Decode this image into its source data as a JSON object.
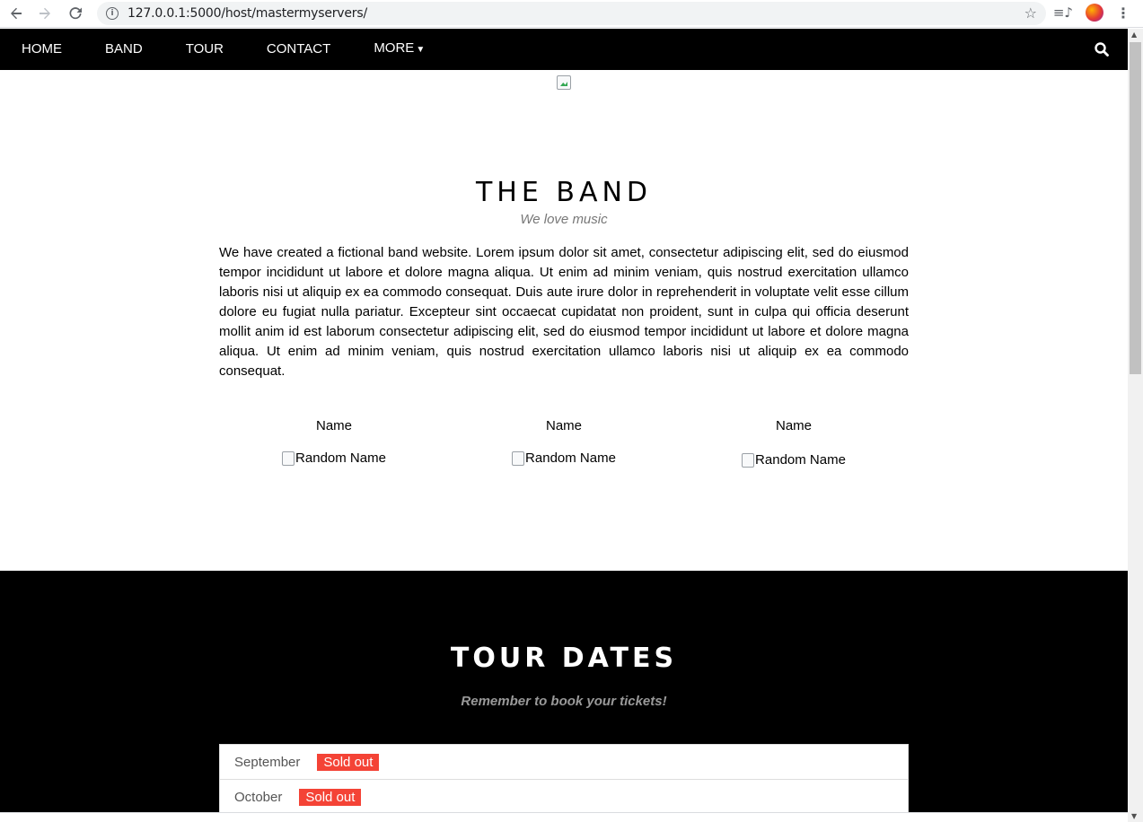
{
  "browser": {
    "url": "127.0.0.1:5000/host/mastermyservers/"
  },
  "nav": {
    "items": [
      "HOME",
      "BAND",
      "TOUR",
      "CONTACT",
      "MORE"
    ],
    "more_caret": "▼"
  },
  "band": {
    "title": "THE BAND",
    "subtitle": "We love music",
    "text": "We have created a fictional band website. Lorem ipsum dolor sit amet, consectetur adipiscing elit, sed do eiusmod tempor incididunt ut labore et dolore magna aliqua. Ut enim ad minim veniam, quis nostrud exercitation ullamco laboris nisi ut aliquip ex ea commodo consequat. Duis aute irure dolor in reprehenderit in voluptate velit esse cillum dolore eu fugiat nulla pariatur. Excepteur sint occaecat cupidatat non proident, sunt in culpa qui officia deserunt mollit anim id est laborum consectetur adipiscing elit, sed do eiusmod tempor incididunt ut labore et dolore magna aliqua. Ut enim ad minim veniam, quis nostrud exercitation ullamco laboris nisi ut aliquip ex ea commodo consequat.",
    "members": [
      {
        "name": "Name",
        "img_alt": "Random Name"
      },
      {
        "name": "Name",
        "img_alt": "Random Name"
      },
      {
        "name": "Name",
        "img_alt": "Random Name"
      }
    ]
  },
  "tour": {
    "title": "TOUR DATES",
    "subtitle": "Remember to book your tickets!",
    "dates": [
      {
        "month": "September",
        "badge": "Sold out"
      },
      {
        "month": "October",
        "badge": "Sold out"
      }
    ]
  },
  "colors": {
    "nav_bg": "#000000",
    "badge": "#f44336",
    "subtitle_grey": "#777777"
  }
}
